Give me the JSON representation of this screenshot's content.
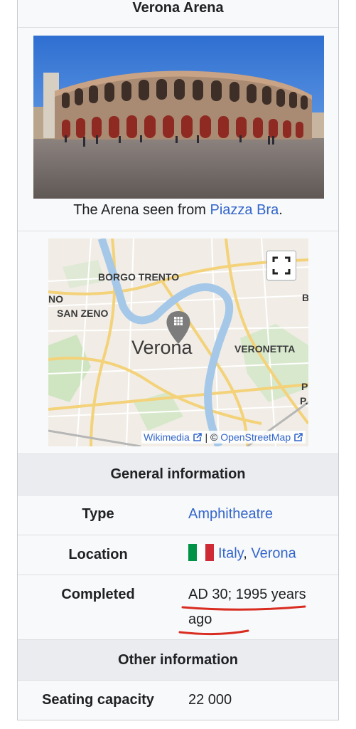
{
  "infobox": {
    "title": "Verona Arena",
    "image_caption_prefix": "The Arena seen from ",
    "image_caption_link": "Piazza Bra",
    "image_caption_suffix": ".",
    "map": {
      "labels": [
        "BORGO TRENTO",
        "SAN ZENO",
        "Verona",
        "VERONETTA",
        "NO",
        "B",
        "P",
        "P."
      ],
      "attribution_wikimedia": "Wikimedia",
      "attribution_sep": " | © ",
      "attribution_osm": "OpenStreetMap",
      "fullscreen_icon": "fullscreen-icon",
      "marker_icon": "building-marker-icon"
    },
    "sections": {
      "general": "General information",
      "other": "Other information"
    },
    "rows": {
      "type_label": "Type",
      "type_value": "Amphitheatre",
      "location_label": "Location",
      "location_country": "Italy",
      "location_sep": ", ",
      "location_city": "Verona",
      "completed_label": "Completed",
      "completed_value_line1": "AD 30; 1995 years",
      "completed_value_line2": "ago",
      "seating_label": "Seating capacity",
      "seating_value": "22 000"
    },
    "colors": {
      "link": "#3366cc",
      "annotation": "#d92c20",
      "section_bg": "#eaecf0",
      "flag": [
        "#009246",
        "#ffffff",
        "#ce2b37"
      ]
    }
  }
}
